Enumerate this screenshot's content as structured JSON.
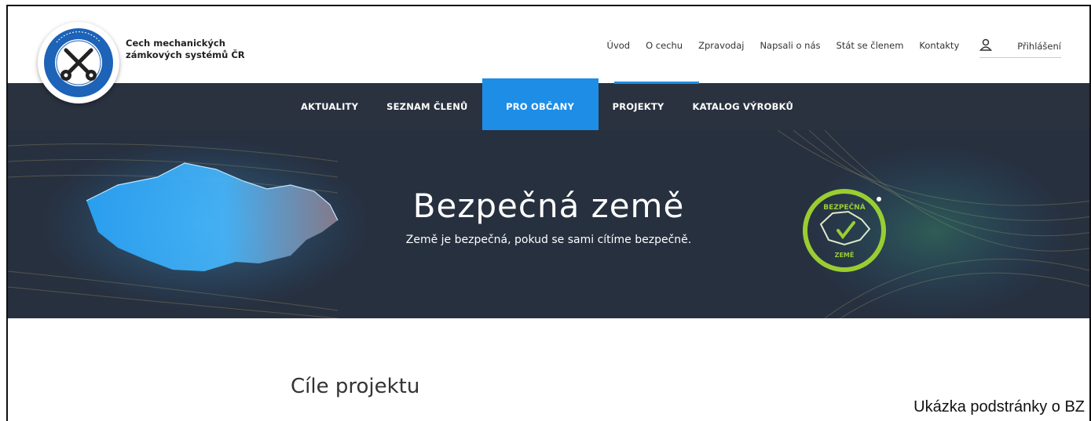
{
  "brand": {
    "line1": "Cech mechanických",
    "line2": "zámkových systémů ČR"
  },
  "top_nav": [
    "Úvod",
    "O cechu",
    "Zpravodaj",
    "Napsali o nás",
    "Stát se členem",
    "Kontakty"
  ],
  "login_label": "Přihlášení",
  "main_nav": [
    {
      "label": "AKTUALITY",
      "active": false
    },
    {
      "label": "SEZNAM ČLENŮ",
      "active": false
    },
    {
      "label": "PRO OBČANY",
      "active": true
    },
    {
      "label": "PROJEKTY",
      "active": false
    },
    {
      "label": "KATALOG VÝROBKŮ",
      "active": false
    }
  ],
  "hero": {
    "title": "Bezpečná země",
    "subtitle": "Země je bezpečná, pokud se sami cítíme bezpečně.",
    "badge_top": "BEZPEČNÁ",
    "badge_bottom": "ZEMĚ"
  },
  "section_title": "Cíle projektu",
  "caption": "Ukázka podstránky o BZ",
  "colors": {
    "accent": "#1e8de6",
    "nav_bg": "#2a313f",
    "hero_bg": "#27303f",
    "badge": "#9acd32"
  }
}
